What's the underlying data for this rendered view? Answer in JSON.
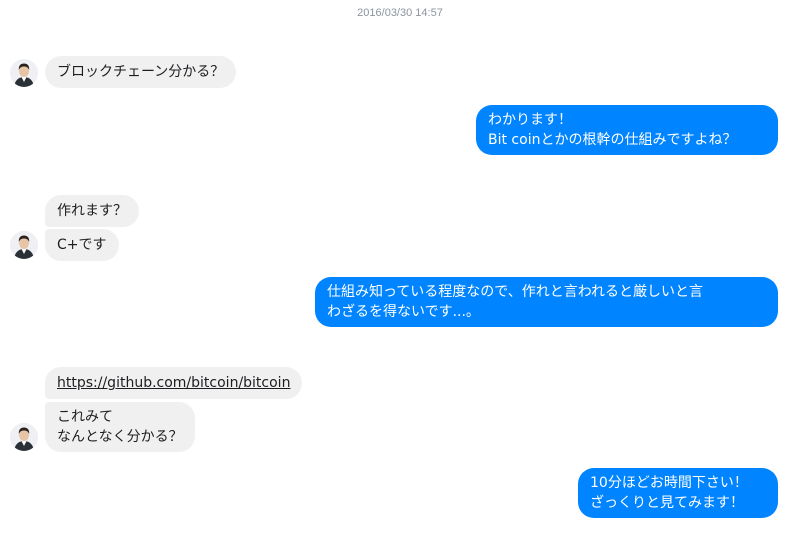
{
  "conversation": {
    "timestamp": "2016/03/30 14:57",
    "messages": {
      "m1": "ブロックチェーン分かる？",
      "m2_line1": "わかります！",
      "m2_line2": "Bit coinとかの根幹の仕組みですよね？",
      "m3": "作れます？",
      "m4": "C+です",
      "m5_line1": "仕組み知っている程度なので、作れと言われると厳しいと言",
      "m5_line2": "わざるを得ないです...。",
      "m6_link": "https://github.com/bitcoin/bitcoin",
      "m7_line1": "これみて",
      "m7_line2": "なんとなく分かる？",
      "m8_line1": "10分ほどお時間下さい！",
      "m8_line2": "ざっくりと見てみます！"
    }
  },
  "colors": {
    "outgoing_bubble": "#0084ff",
    "incoming_bubble": "#f1f0f0",
    "timestamp_text": "#8d949e"
  },
  "icons": {
    "avatar": "contact-avatar-icon"
  }
}
